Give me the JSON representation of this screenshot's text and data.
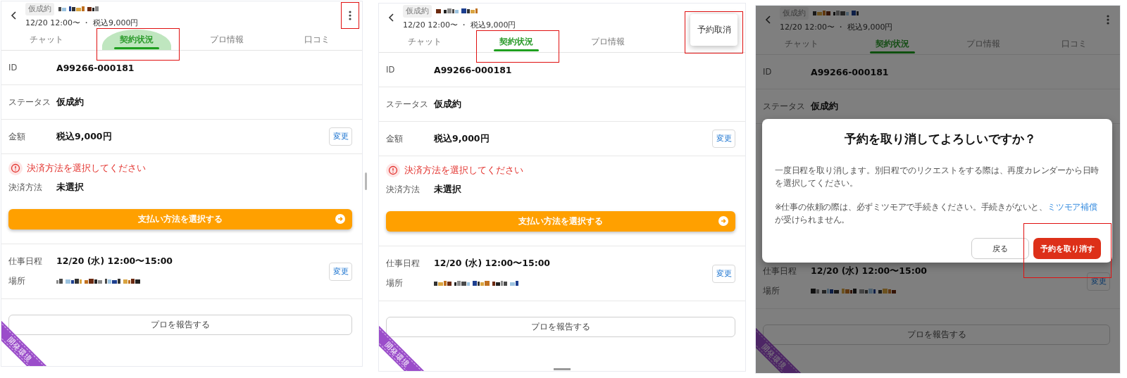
{
  "panels": [
    {
      "header": {
        "badge": "仮成約",
        "subtitle": "12/20 12:00〜 ・ 税込9,000円",
        "menu_button": true,
        "menu_highlighted": true
      },
      "tabs": [
        {
          "label": "チャット",
          "selected": false,
          "pressed": false,
          "highlighted": false
        },
        {
          "label": "契約状況",
          "selected": true,
          "pressed": true,
          "highlighted": true
        },
        {
          "label": "プロ情報",
          "selected": false,
          "pressed": false,
          "highlighted": false
        },
        {
          "label": "口コミ",
          "selected": false,
          "pressed": false,
          "highlighted": false
        }
      ],
      "content": [
        {
          "kind": "field",
          "label": "ID",
          "value": "A99266-000181"
        },
        {
          "kind": "field",
          "label": "ステータス",
          "value": "仮成約"
        },
        {
          "kind": "field",
          "label": "金額",
          "value": "税込9,000円",
          "action": "変更"
        },
        {
          "kind": "payment",
          "alert": "決済方法を選択してください",
          "label": "決済方法",
          "value": "未選択",
          "button": "支払い方法を選択する"
        },
        {
          "kind": "schedule",
          "date_label": "仕事日程",
          "date": "12/20 (水) 12:00〜15:00",
          "place_label": "場所",
          "action": "変更"
        },
        {
          "kind": "report",
          "button": "プロを報告する"
        }
      ],
      "ribbon": "開発環境"
    },
    {
      "header": {
        "badge": "仮成約",
        "subtitle": "12/20 12:00〜 ・ 税込9,000円"
      },
      "popup_menu": {
        "items": [
          {
            "label": "予約取消"
          }
        ],
        "highlighted": true
      },
      "tabs": [
        {
          "label": "チャット",
          "selected": false,
          "pressed": false,
          "highlighted": false
        },
        {
          "label": "契約状況",
          "selected": true,
          "pressed": false,
          "highlighted": true
        },
        {
          "label": "プロ情報",
          "selected": false,
          "pressed": false,
          "highlighted": false
        }
      ],
      "content": [
        {
          "kind": "field",
          "label": "ID",
          "value": "A99266-000181"
        },
        {
          "kind": "field",
          "label": "ステータス",
          "value": "仮成約"
        },
        {
          "kind": "field",
          "label": "金額",
          "value": "税込9,000円",
          "action": "変更"
        },
        {
          "kind": "payment",
          "alert": "決済方法を選択してください",
          "label": "決済方法",
          "value": "未選択",
          "button": "支払い方法を選択する"
        },
        {
          "kind": "schedule",
          "date_label": "仕事日程",
          "date": "12/20 (水) 12:00〜15:00",
          "place_label": "場所",
          "action": "変更"
        },
        {
          "kind": "report",
          "button": "プロを報告する"
        }
      ],
      "ribbon": "開発環境"
    },
    {
      "header": {
        "badge": "仮成約",
        "subtitle": "12/20 12:00〜 ・ 税込9,000円",
        "menu_button": true,
        "menu_highlighted": false
      },
      "tabs": [
        {
          "label": "チャット",
          "selected": false,
          "pressed": false,
          "highlighted": false
        },
        {
          "label": "契約状況",
          "selected": true,
          "pressed": false,
          "highlighted": false
        },
        {
          "label": "プロ情報",
          "selected": false,
          "pressed": false,
          "highlighted": false
        },
        {
          "label": "口コミ",
          "selected": false,
          "pressed": false,
          "highlighted": false
        }
      ],
      "content": [
        {
          "kind": "field",
          "label": "ID",
          "value": "A99266-000181"
        },
        {
          "kind": "field",
          "label": "ステータス",
          "value": "仮成約"
        },
        {
          "kind": "dialog",
          "title": "予約を取り消してよろしいですか？",
          "body": "一度日程を取り消します。別日程でのリクエストをする際は、再度カレンダーから日時を選択してください。",
          "note": "※仕事の依頼の際は、必ずミツモアで手続きください。手続きがないと、",
          "link": "ミツモア補償",
          "note_end": "が受けられません。",
          "buttons": [
            {
              "label": "戻る",
              "kind": "secondary",
              "highlighted": false
            },
            {
              "label": "予約を取り消す",
              "kind": "danger",
              "highlighted": true
            }
          ]
        },
        {
          "kind": "schedule",
          "date_label": "仕事日程",
          "date": "12/20 (水) 12:00〜15:00",
          "place_label": "場所",
          "action": "変更"
        },
        {
          "kind": "report",
          "button": "プロを報告する"
        }
      ],
      "ribbon": "開発環境",
      "dimmed": true
    }
  ]
}
